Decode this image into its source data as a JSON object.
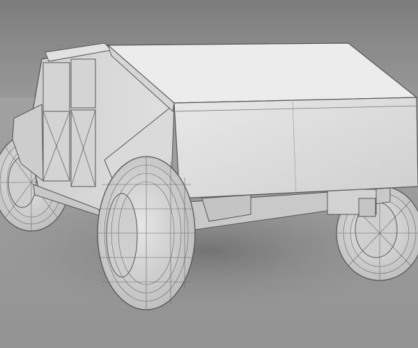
{
  "scene": {
    "background_top": "#8a8a8a",
    "background_floor": "#9a9a9a",
    "model_color": "#d8d8d8",
    "wire_color": "#555555",
    "shadow_color": "#7a7a7a"
  }
}
